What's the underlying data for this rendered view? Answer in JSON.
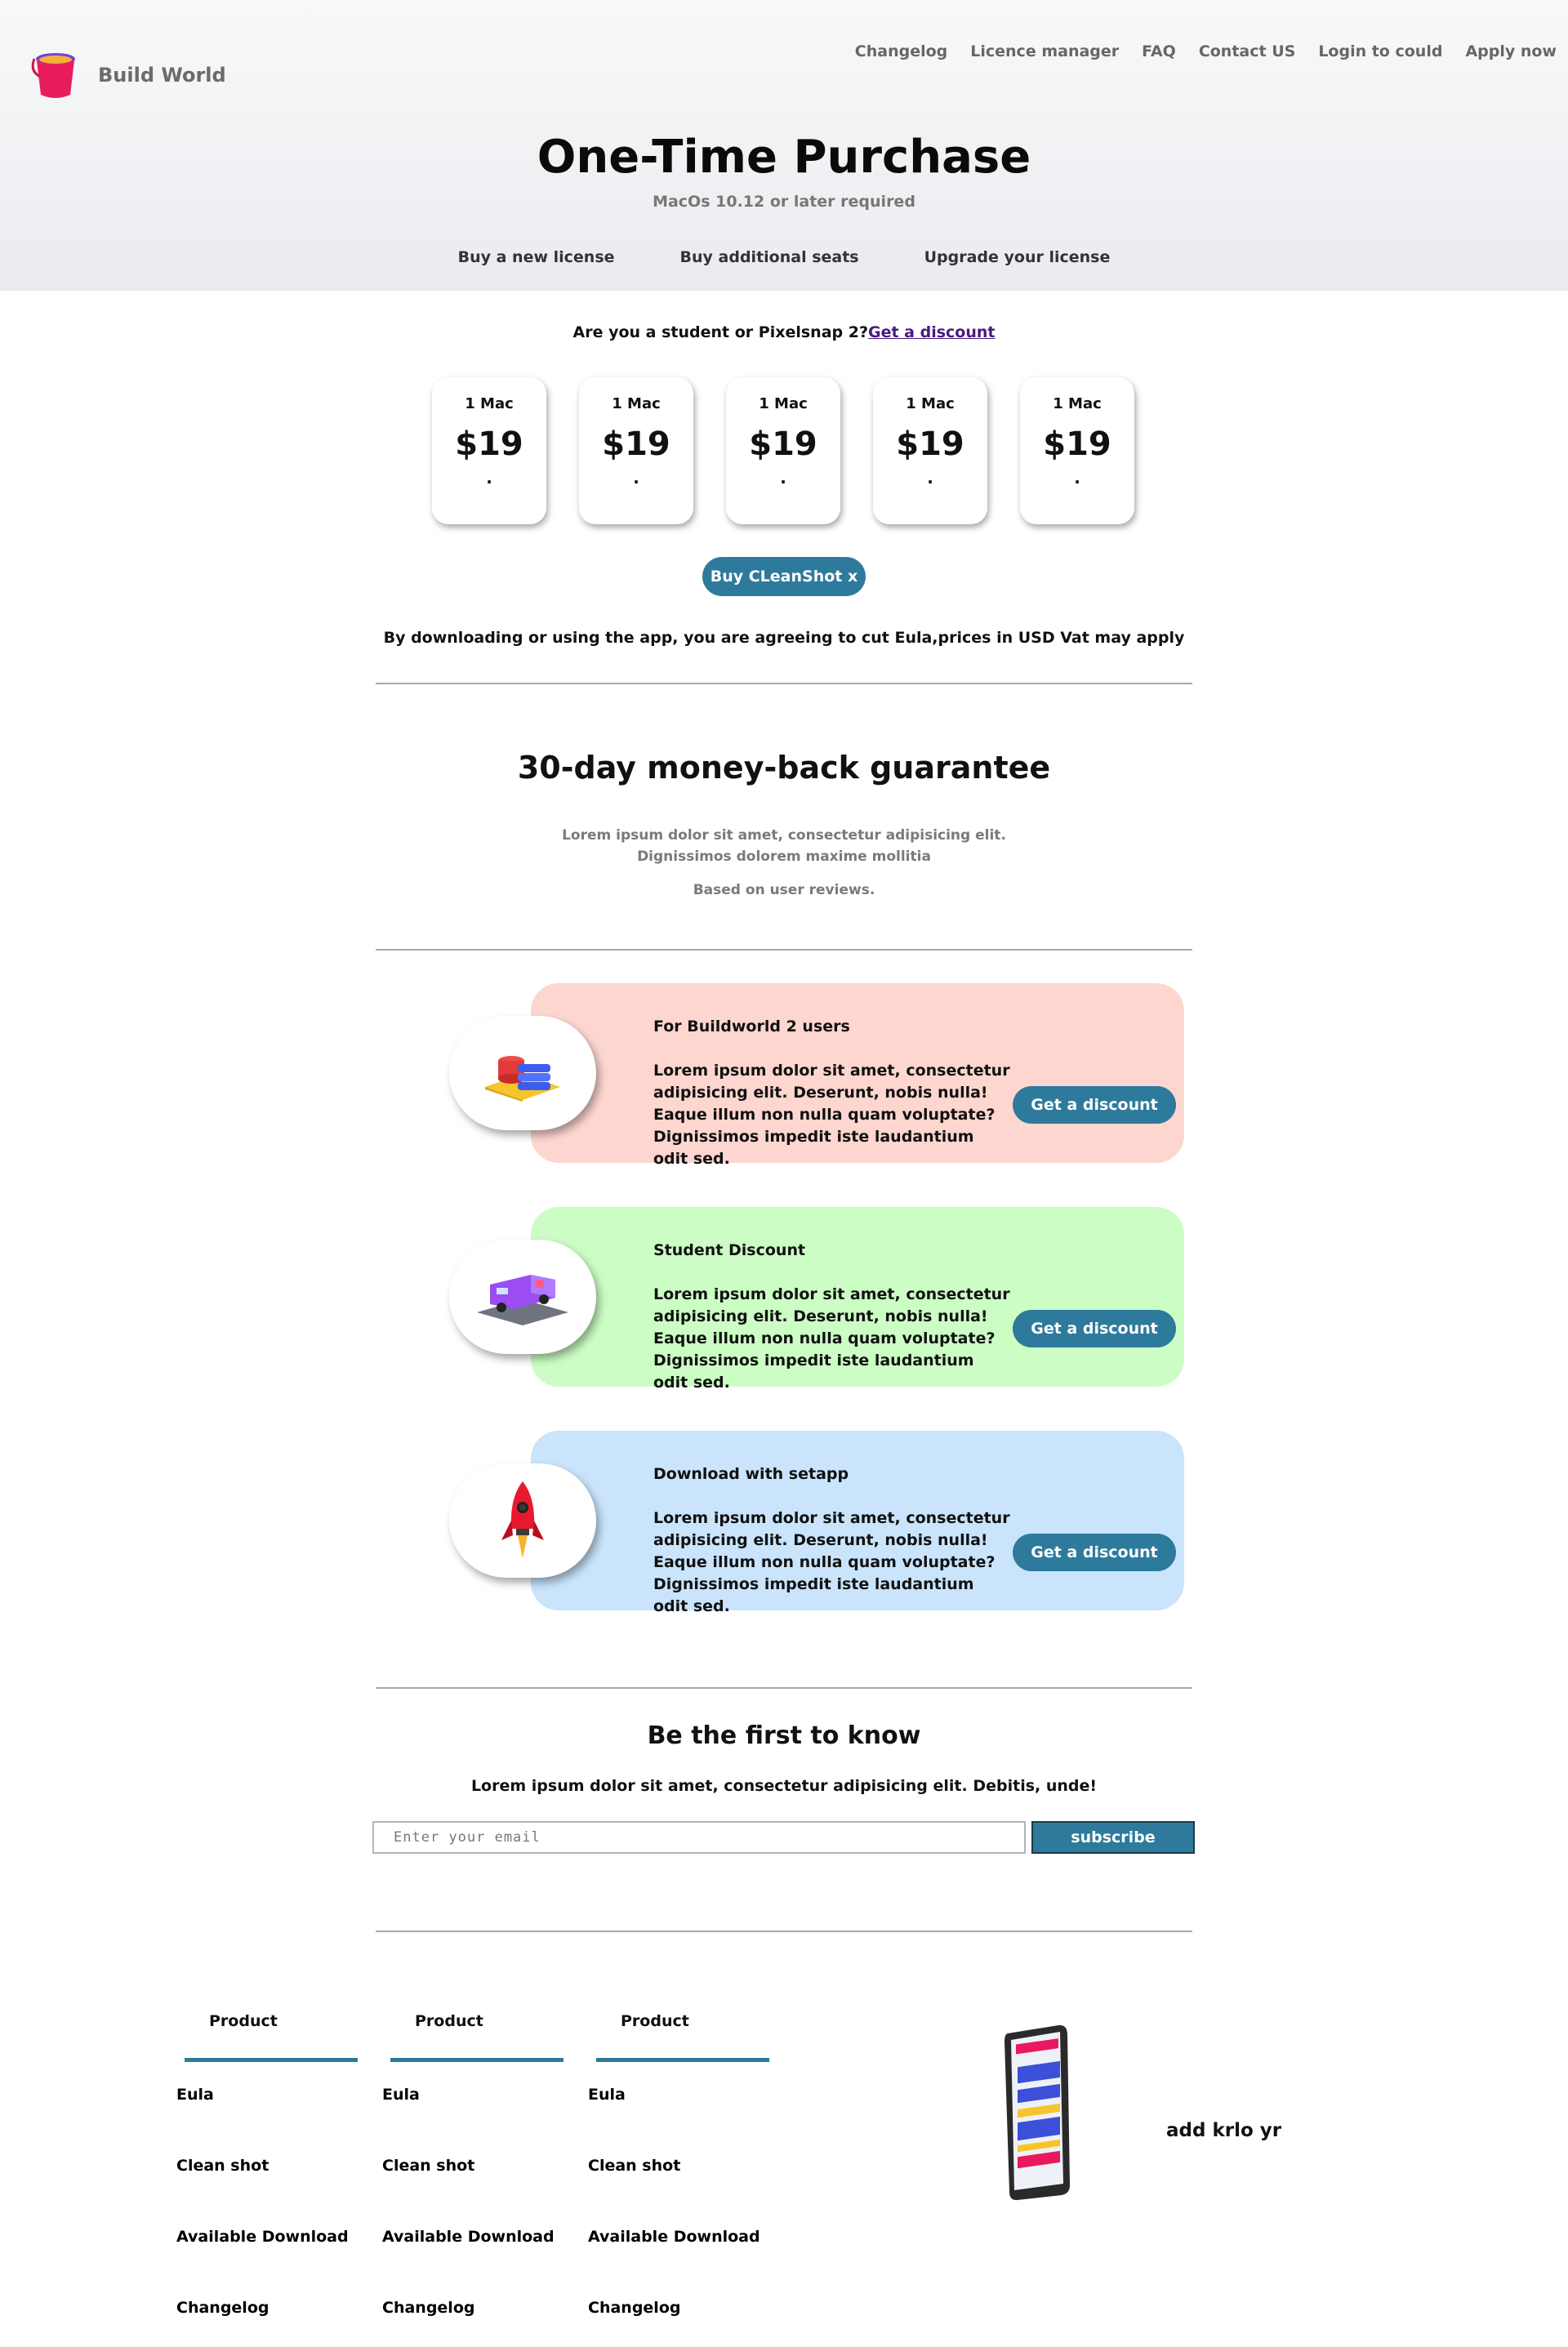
{
  "header": {
    "brand": "Build World",
    "nav": [
      "Changelog",
      "Licence manager",
      "FAQ",
      "Contact US",
      "Login to could",
      "Apply now"
    ],
    "title": "One-Time Purchase",
    "subtitle": "MacOs 10.12 or later required",
    "tabs": [
      "Buy a new license",
      "Buy additional seats",
      "Upgrade your license"
    ]
  },
  "pricing": {
    "student_prompt": "Are you a student or Pixelsnap 2?",
    "student_link": "Get a discount",
    "cards": [
      {
        "label": "1 Mac",
        "price": "$19",
        "note": "."
      },
      {
        "label": "1 Mac",
        "price": "$19",
        "note": "."
      },
      {
        "label": "1 Mac",
        "price": "$19",
        "note": "."
      },
      {
        "label": "1 Mac",
        "price": "$19",
        "note": "."
      },
      {
        "label": "1 Mac",
        "price": "$19",
        "note": "."
      }
    ],
    "buy_button": "Buy CLeanShot x",
    "agreement": "By downloading or using the app, you are agreeing to cut Eula,prices in USD Vat may apply"
  },
  "guarantee": {
    "title": "30-day money-back guarantee",
    "line1": "Lorem ipsum dolor sit amet, consectetur adipisicing elit.",
    "line2": "Dignissimos dolorem maxime mollitia",
    "note": "Based on user reviews."
  },
  "offers": [
    {
      "title": "For Buildworld 2 users",
      "text": "Lorem ipsum dolor sit amet, consectetur adipisicing elit. Deserunt, nobis nulla! Eaque illum non nulla quam voluptate? Dignissimos impedit iste laudantium odit sed.",
      "button": "Get a discount",
      "bg": "#fdd6d0",
      "icon": "books-icon"
    },
    {
      "title": "Student Discount",
      "text": "Lorem ipsum dolor sit amet, consectetur adipisicing elit. Deserunt, nobis nulla! Eaque illum non nulla quam voluptate? Dignissimos impedit iste laudantium odit sed.",
      "button": "Get a discount",
      "bg": "#cbfdc4",
      "icon": "ambulance-icon"
    },
    {
      "title": "Download with setapp",
      "text": "Lorem ipsum dolor sit amet, consectetur adipisicing elit. Deserunt, nobis nulla! Eaque illum non nulla quam voluptate? Dignissimos impedit iste laudantium odit sed.",
      "button": "Get a discount",
      "bg": "#c9e4fb",
      "icon": "rocket-icon"
    }
  ],
  "newsletter": {
    "title": "Be the first to know",
    "text": "Lorem ipsum dolor sit amet, consectetur adipisicing elit. Debitis, unde!",
    "placeholder": "Enter your email",
    "button": "subscribe"
  },
  "footer": {
    "columns": [
      {
        "title": "Product",
        "links": [
          "Eula",
          "Clean shot",
          "Available Download",
          "Changelog"
        ]
      },
      {
        "title": "Product",
        "links": [
          "Eula",
          "Clean shot",
          "Available Download",
          "Changelog"
        ]
      },
      {
        "title": "Product",
        "links": [
          "Eula",
          "Clean shot",
          "Available Download",
          "Changelog"
        ]
      }
    ],
    "side_text": "add krlo yr"
  },
  "colors": {
    "accent": "#2e7a9c",
    "link": "#4a1a80",
    "hero_bg": "#eceef1"
  }
}
